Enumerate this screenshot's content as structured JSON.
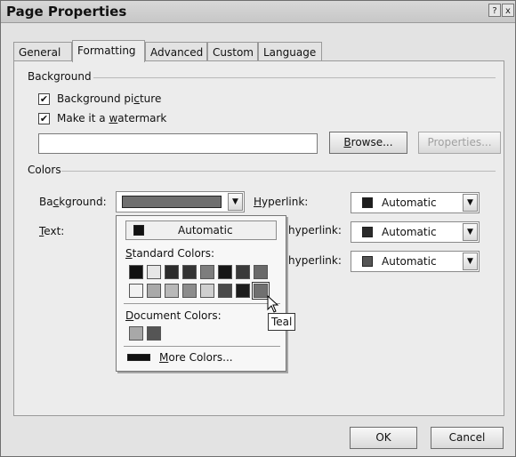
{
  "window": {
    "title": "Page Properties",
    "help_glyph": "?",
    "close_glyph": "x"
  },
  "tabs": [
    "General",
    "Formatting",
    "Advanced",
    "Custom",
    "Language"
  ],
  "active_tab": "Formatting",
  "background_group": {
    "title": "Background",
    "bg_picture_label": "Background picture",
    "bg_picture_checked": true,
    "watermark_label": "Make it a watermark",
    "watermark_checked": true,
    "path_value": "",
    "browse_label": "Browse...",
    "properties_label": "Properties..."
  },
  "colors_group": {
    "title": "Colors",
    "background_label": "Background:",
    "text_label": "Text:",
    "hyperlink_label": "Hyperlink:",
    "visited_label": "hyperlink:",
    "active_label": "hyperlink:",
    "background_swatch": "#6f6f6f",
    "hyperlink_value": "Automatic",
    "visited_value": "Automatic",
    "active_value": "Automatic"
  },
  "color_menu": {
    "automatic_label": "Automatic",
    "standard_colors_label": "Standard Colors:",
    "standard_row1": [
      "#111111",
      "#e6e6e6",
      "#2b2b2b",
      "#333333",
      "#7d7d7d",
      "#161616",
      "#3a3a3a",
      "#6a6a6a"
    ],
    "standard_row2": [
      "#f2f2f2",
      "#a9a9a9",
      "#b8b8b8",
      "#8c8c8c",
      "#cfcfcf",
      "#4a4a4a",
      "#1c1c1c",
      "#707070"
    ],
    "document_colors_label": "Document Colors:",
    "document_colors": [
      "#a8a8a8",
      "#555555"
    ],
    "more_colors_label": "More Colors...",
    "tooltip": "Teal"
  },
  "footer": {
    "ok_label": "OK",
    "cancel_label": "Cancel"
  }
}
